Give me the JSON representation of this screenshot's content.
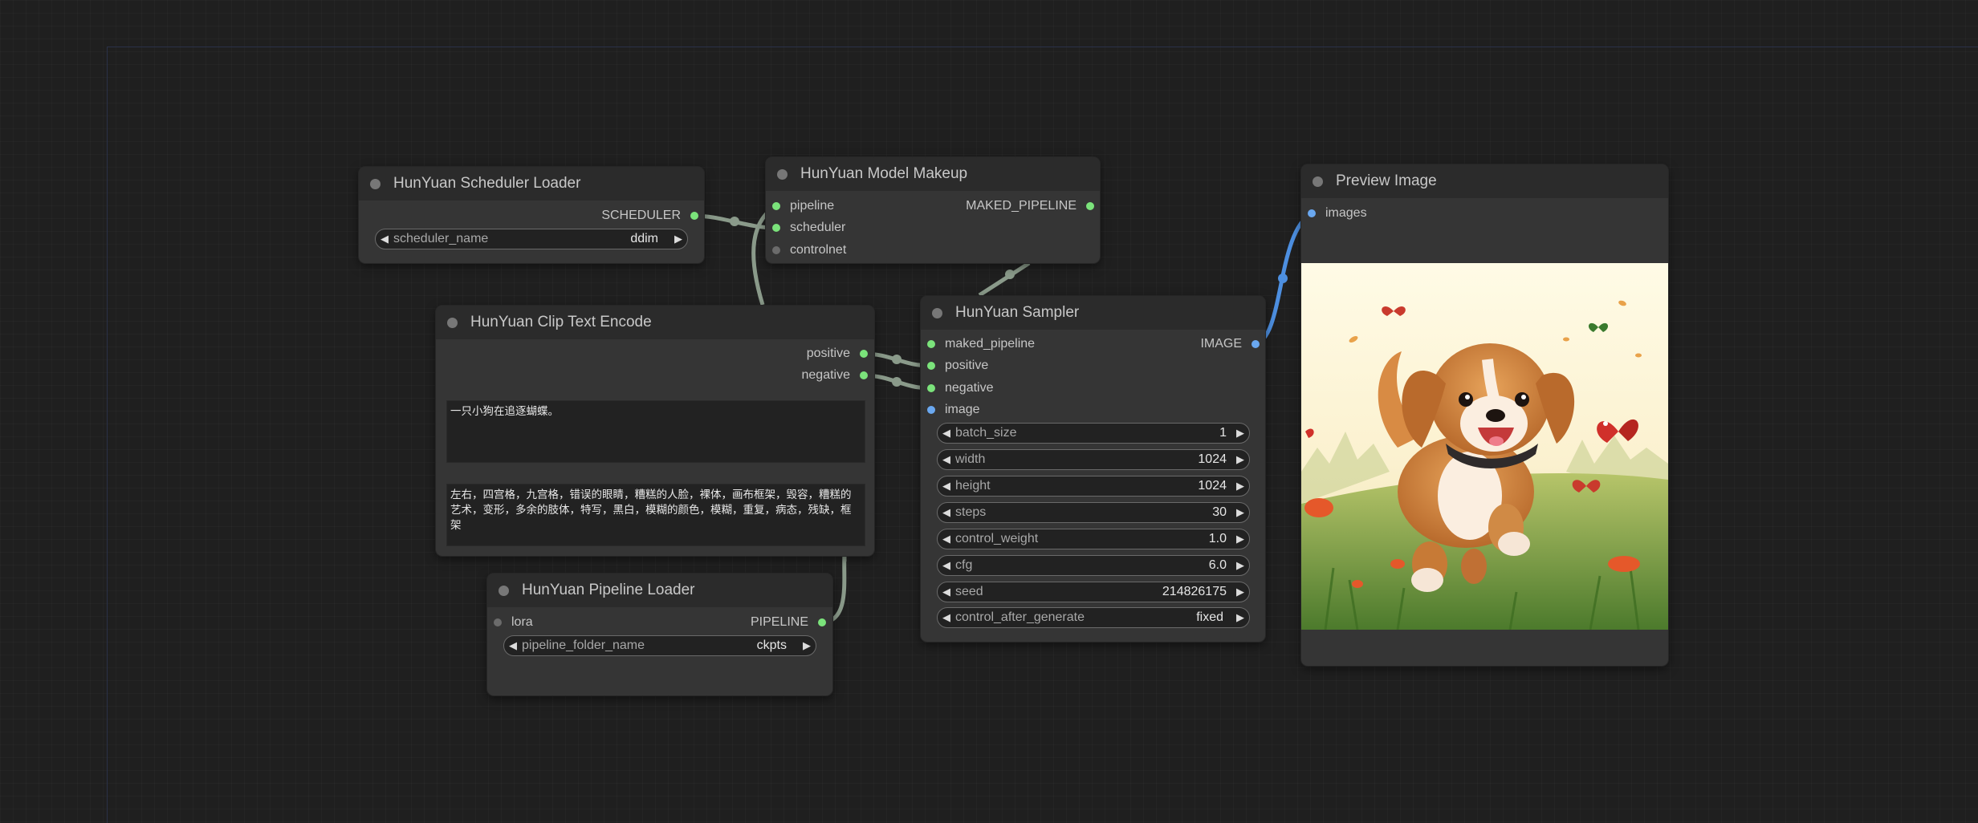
{
  "nodes": {
    "scheduler_loader": {
      "title": "HunYuan Scheduler Loader",
      "outputs": [
        "SCHEDULER"
      ],
      "widget": {
        "label": "scheduler_name",
        "value": "ddim"
      }
    },
    "model_makeup": {
      "title": "HunYuan Model Makeup",
      "inputs": [
        "pipeline",
        "scheduler",
        "controlnet"
      ],
      "outputs": [
        "MAKED_PIPELINE"
      ]
    },
    "clip_text_encode": {
      "title": "HunYuan Clip Text Encode",
      "outputs": [
        "positive",
        "negative"
      ],
      "positive_text": "一只小狗在追逐蝴蝶。",
      "negative_text": "左右，四宫格，九宫格，错误的眼睛，糟糕的人脸，裸体，画布框架，毁容，糟糕的艺术，变形，多余的肢体，特写，黑白，模糊的颜色，模糊，重复，病态，残缺，框架"
    },
    "pipeline_loader": {
      "title": "HunYuan Pipeline Loader",
      "inputs": [
        "lora"
      ],
      "outputs": [
        "PIPELINE"
      ],
      "widget": {
        "label": "pipeline_folder_name",
        "value": "ckpts"
      }
    },
    "sampler": {
      "title": "HunYuan Sampler",
      "inputs": [
        "maked_pipeline",
        "positive",
        "negative",
        "image"
      ],
      "outputs": [
        "IMAGE"
      ],
      "widgets": [
        {
          "label": "batch_size",
          "value": "1"
        },
        {
          "label": "width",
          "value": "1024"
        },
        {
          "label": "height",
          "value": "1024"
        },
        {
          "label": "steps",
          "value": "30"
        },
        {
          "label": "control_weight",
          "value": "1.0"
        },
        {
          "label": "cfg",
          "value": "6.0"
        },
        {
          "label": "seed",
          "value": "214826175"
        },
        {
          "label": "control_after_generate",
          "value": "fixed"
        }
      ]
    },
    "preview_image": {
      "title": "Preview Image",
      "inputs": [
        "images"
      ]
    }
  },
  "colors": {
    "link_default": "#8a9a8a",
    "link_image": "#4d8fe0",
    "slot_green": "#7be37b",
    "slot_blue": "#6aa8f0"
  },
  "preview": {
    "subject": "puppy-chasing-butterflies-image"
  }
}
